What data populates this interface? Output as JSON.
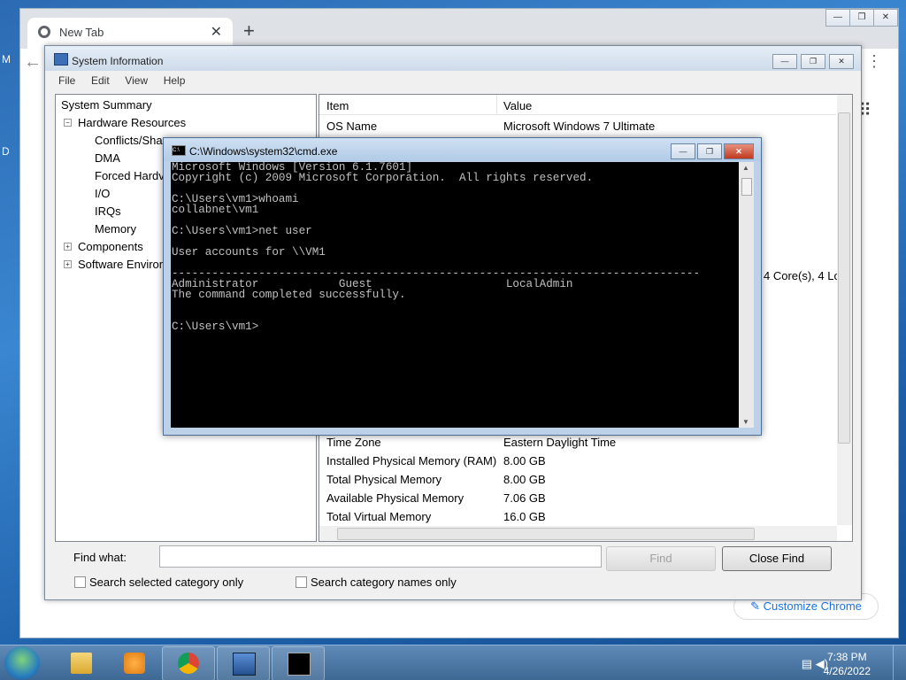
{
  "desktop": {
    "edge_text_1": "M",
    "edge_text_2": "D"
  },
  "chrome": {
    "tab_title": "New Tab",
    "tab_close": "✕",
    "new_tab": "+",
    "back": "←",
    "menu": "⋮",
    "apps": "⠿",
    "customize_label": "Customize Chrome",
    "window_buttons": [
      "—",
      "❐",
      "✕"
    ]
  },
  "msinfo": {
    "title": "System Information",
    "menu": [
      "File",
      "Edit",
      "View",
      "Help"
    ],
    "window_buttons": [
      "—",
      "❐",
      "✕"
    ],
    "tree": {
      "root": "System Summary",
      "hardware": "Hardware Resources",
      "conflicts": "Conflicts/Shar",
      "dma": "DMA",
      "forced": "Forced Hardv",
      "io": "I/O",
      "irqs": "IRQs",
      "memory": "Memory",
      "components": "Components",
      "software": "Software Environ"
    },
    "columns": {
      "item": "Item",
      "value": "Value"
    },
    "rows_top": [
      {
        "item": "OS Name",
        "value": "Microsoft Windows 7 Ultimate"
      }
    ],
    "cores_fragment": "4 Core(s), 4 Lo",
    "rows_bottom": [
      {
        "item": "Time Zone",
        "value": "Eastern Daylight Time"
      },
      {
        "item": "Installed Physical Memory (RAM)",
        "value": "8.00 GB"
      },
      {
        "item": "Total Physical Memory",
        "value": "8.00 GB"
      },
      {
        "item": "Available Physical Memory",
        "value": "7.06 GB"
      },
      {
        "item": "Total Virtual Memory",
        "value": "16.0 GB"
      }
    ],
    "find_label": "Find what:",
    "find_value": "",
    "find_button": "Find",
    "close_find_button": "Close Find",
    "check_selected": "Search selected category only",
    "check_names": "Search category names only"
  },
  "cmd": {
    "title": "C:\\Windows\\system32\\cmd.exe",
    "window_buttons": [
      "—",
      "❐",
      "✕"
    ],
    "lines": [
      "Microsoft Windows [Version 6.1.7601]",
      "Copyright (c) 2009 Microsoft Corporation.  All rights reserved.",
      "",
      "C:\\Users\\vm1>whoami",
      "collabnet\\vm1",
      "",
      "C:\\Users\\vm1>net user",
      "",
      "User accounts for \\\\VM1",
      "",
      "-------------------------------------------------------------------------------",
      "Administrator            Guest                    LocalAdmin",
      "The command completed successfully.",
      "",
      "",
      "C:\\Users\\vm1>"
    ]
  },
  "taskbar": {
    "time": "7:38 PM",
    "date": "4/26/2022",
    "apps": [
      "windows-explorer",
      "media-player",
      "chrome",
      "system-information",
      "command-prompt"
    ]
  }
}
